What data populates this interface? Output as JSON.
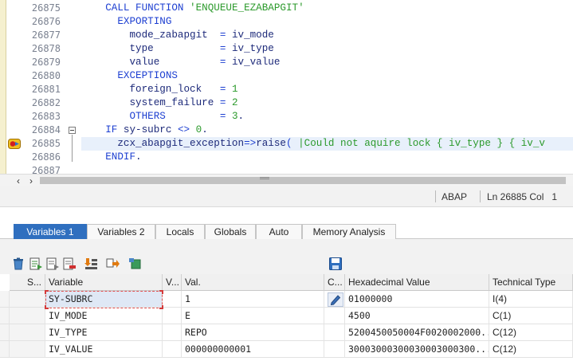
{
  "editor": {
    "lines": [
      {
        "num": "26875",
        "segments": [
          [
            "    ",
            ""
          ],
          [
            "CALL FUNCTION ",
            "kw"
          ],
          [
            "'ENQUEUE_EZABAPGIT'",
            "str"
          ]
        ]
      },
      {
        "num": "26876",
        "segments": [
          [
            "      ",
            ""
          ],
          [
            "EXPORTING",
            "kw"
          ]
        ]
      },
      {
        "num": "26877",
        "segments": [
          [
            "        mode_zabapgit  ",
            ""
          ],
          [
            "=",
            "op"
          ],
          [
            " iv_mode",
            ""
          ]
        ]
      },
      {
        "num": "26878",
        "segments": [
          [
            "        type           ",
            ""
          ],
          [
            "=",
            "op"
          ],
          [
            " iv_type",
            ""
          ]
        ]
      },
      {
        "num": "26879",
        "segments": [
          [
            "        value          ",
            ""
          ],
          [
            "=",
            "op"
          ],
          [
            " iv_value",
            ""
          ]
        ]
      },
      {
        "num": "26880",
        "segments": [
          [
            "      ",
            ""
          ],
          [
            "EXCEPTIONS",
            "kw"
          ]
        ]
      },
      {
        "num": "26881",
        "segments": [
          [
            "        foreign_lock   ",
            ""
          ],
          [
            "=",
            "op"
          ],
          [
            " ",
            ""
          ],
          [
            "1",
            "num"
          ]
        ]
      },
      {
        "num": "26882",
        "segments": [
          [
            "        system_failure ",
            ""
          ],
          [
            "=",
            "op"
          ],
          [
            " ",
            ""
          ],
          [
            "2",
            "num"
          ]
        ]
      },
      {
        "num": "26883",
        "segments": [
          [
            "        ",
            ""
          ],
          [
            "OTHERS",
            "kw"
          ],
          [
            "         ",
            ""
          ],
          [
            "=",
            "op"
          ],
          [
            " ",
            ""
          ],
          [
            "3",
            "num"
          ],
          [
            ".",
            ""
          ]
        ]
      },
      {
        "num": "26884",
        "segments": [
          [
            "    ",
            ""
          ],
          [
            "IF",
            "kw"
          ],
          [
            " sy-subrc ",
            ""
          ],
          [
            "<>",
            "op"
          ],
          [
            " ",
            ""
          ],
          [
            "0",
            "num"
          ],
          [
            ".",
            ""
          ]
        ]
      },
      {
        "num": "26885",
        "segments": [
          [
            "      zcx_abapgit_exception",
            ""
          ],
          [
            "=>",
            "op"
          ],
          [
            "raise",
            ""
          ],
          [
            "( ",
            "op"
          ],
          [
            "|Could not aquire lock { iv_type } { iv_v",
            "cmt"
          ]
        ]
      },
      {
        "num": "26886",
        "segments": [
          [
            "    ",
            ""
          ],
          [
            "ENDIF",
            "kw"
          ],
          [
            ".",
            ""
          ]
        ]
      },
      {
        "num": "26887",
        "segments": [
          [
            "",
            ""
          ]
        ]
      }
    ],
    "highlight_line": "26885"
  },
  "status_bar": {
    "language": "ABAP",
    "position": "Ln 26885 Col   1"
  },
  "tabs": [
    {
      "label": "Variables 1",
      "active": true
    },
    {
      "label": "Variables 2",
      "active": false
    },
    {
      "label": "Locals",
      "active": false
    },
    {
      "label": "Globals",
      "active": false
    },
    {
      "label": "Auto",
      "active": false
    },
    {
      "label": "Memory Analysis",
      "active": false
    }
  ],
  "toolbar": {
    "icons": [
      "delete-icon",
      "import-variables-icon",
      "copy-variables-icon",
      "remove-variables-icon",
      "sort-icon",
      "transfer-icon",
      "export-icon",
      "save-icon"
    ]
  },
  "grid": {
    "headers": {
      "s": "S...",
      "variable": "Variable",
      "v": "V...",
      "val": "Val.",
      "c": "C...",
      "hex": "Hexadecimal Value",
      "tech": "Technical Type"
    },
    "rows": [
      {
        "variable": "SY-SUBRC",
        "val": "1",
        "hex": "01000000",
        "tech": "I(4)"
      },
      {
        "variable": "IV_MODE",
        "val": "E",
        "hex": "4500",
        "tech": "C(1)"
      },
      {
        "variable": "IV_TYPE",
        "val": "REPO",
        "hex": "5200450050004F0020002000...",
        "tech": "C(12)"
      },
      {
        "variable": "IV_VALUE",
        "val": "000000000001",
        "hex": "30003000300030003000300...",
        "tech": "C(12)"
      }
    ]
  },
  "colors": {
    "tab_active": "#2f6fbf",
    "keyword": "#1d3fd1",
    "string": "#2c9a2c",
    "highlight_line": "#e8f0fb",
    "selection_border": "#e05050"
  }
}
